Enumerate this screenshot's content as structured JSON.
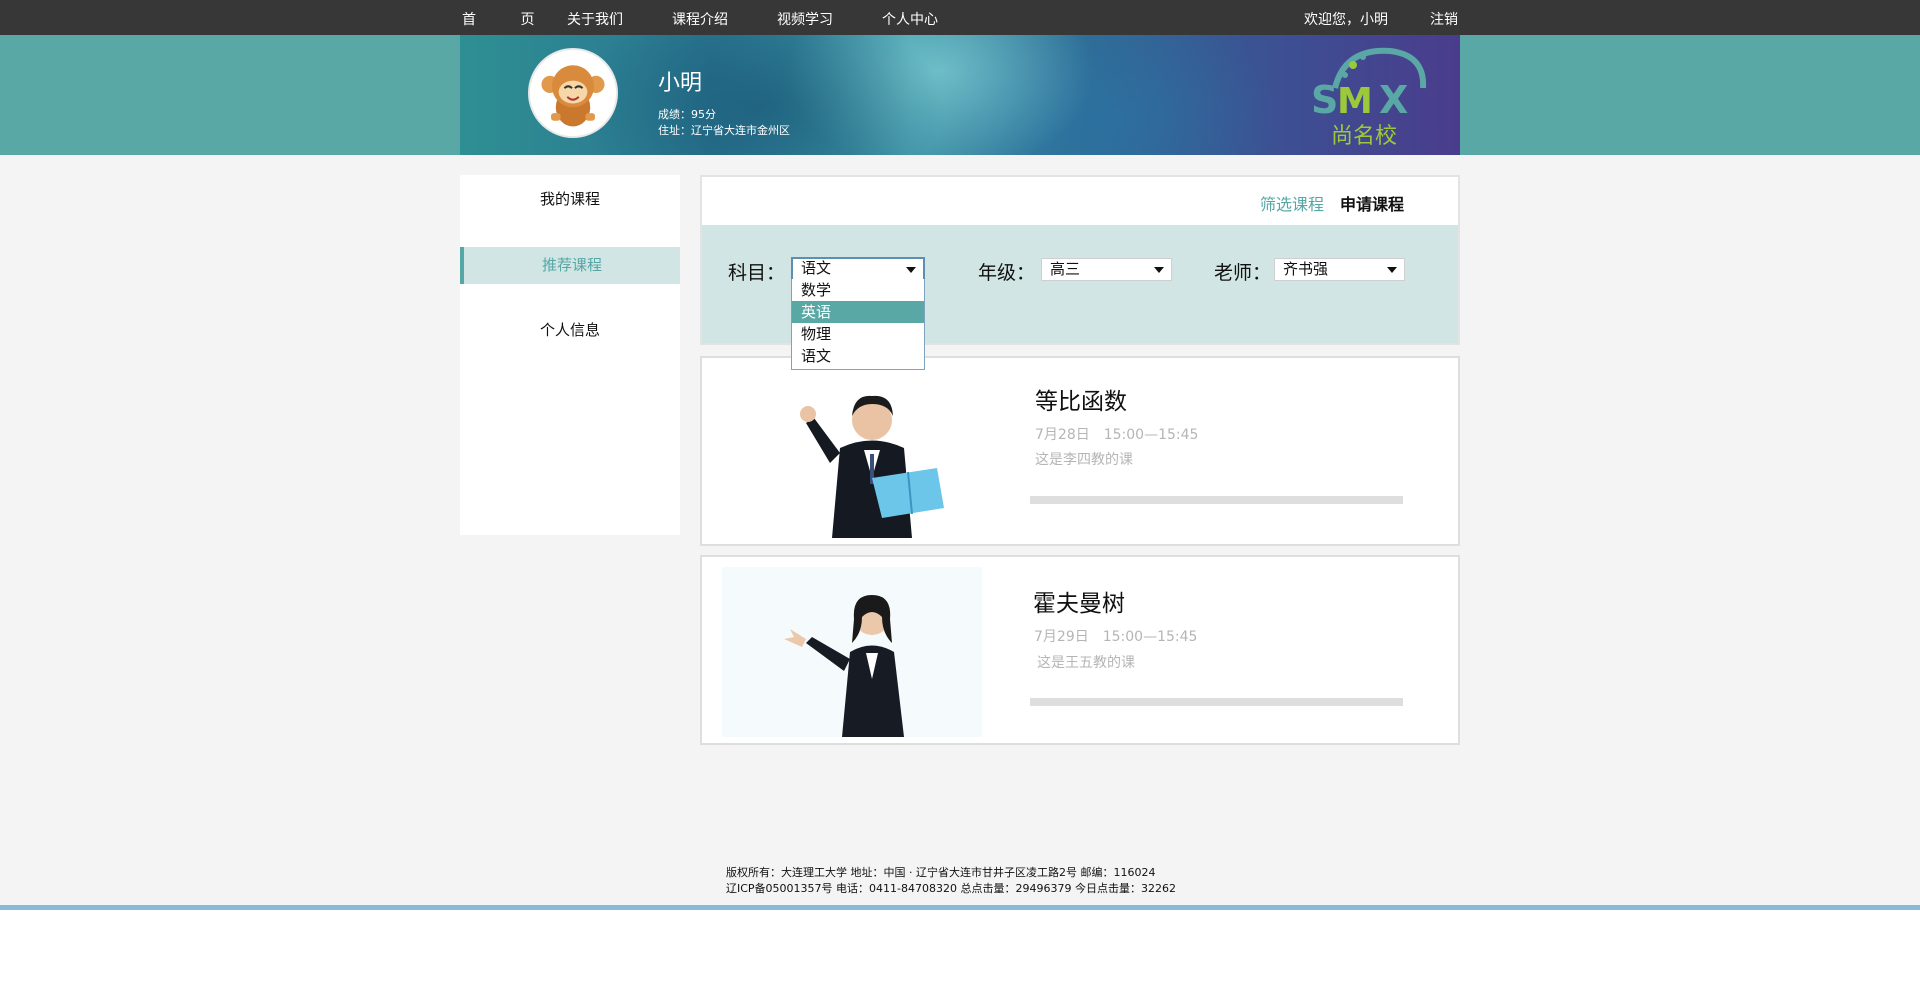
{
  "nav": {
    "items": [
      {
        "label": "首 页"
      },
      {
        "label": "关于我们"
      },
      {
        "label": "课程介绍"
      },
      {
        "label": "视频学习"
      },
      {
        "label": "个人中心"
      }
    ],
    "welcome": "欢迎您，小明",
    "logout": "注销"
  },
  "profile": {
    "name": "小明",
    "score": "成绩：95分",
    "address": "住址：辽宁省大连市金州区"
  },
  "logo": {
    "text": "尚名校",
    "mark": "SMX",
    "colors": [
      "#5aa8a6",
      "#9bc93a"
    ]
  },
  "sidebar": {
    "items": [
      {
        "label": "我的课程",
        "active": false
      },
      {
        "label": "推荐课程",
        "active": true
      },
      {
        "label": "个人信息",
        "active": false
      }
    ]
  },
  "tabs": {
    "filter": "筛选课程",
    "apply": "申请课程"
  },
  "filters": {
    "subject": {
      "label": "科目：",
      "value": "语文",
      "options": [
        "数学",
        "英语",
        "物理",
        "语文"
      ],
      "highlighted": "英语"
    },
    "grade": {
      "label": "年级：",
      "value": "高三"
    },
    "teacher": {
      "label": "老师：",
      "value": "齐书强"
    }
  },
  "courses": [
    {
      "title": "等比函数",
      "time": "7月28日　15:00—15:45",
      "desc": "这是李四教的课"
    },
    {
      "title": "霍夫曼树",
      "time": "7月29日　15:00—15:45",
      "desc": "这是王五教的课"
    }
  ],
  "footer": {
    "line1": "版权所有：大连理工大学  地址：中国 · 辽宁省大连市甘井子区凌工路2号  邮编：116024",
    "line2": "辽ICP备05001357号 电话：0411-84708320 总点击量：29496379 今日点击量：32262"
  },
  "colors": {
    "accent": "#55a7a5",
    "nav_bg": "#373737",
    "filter_bg": "#d1e6e4",
    "page_bg": "#f4f4f4"
  }
}
